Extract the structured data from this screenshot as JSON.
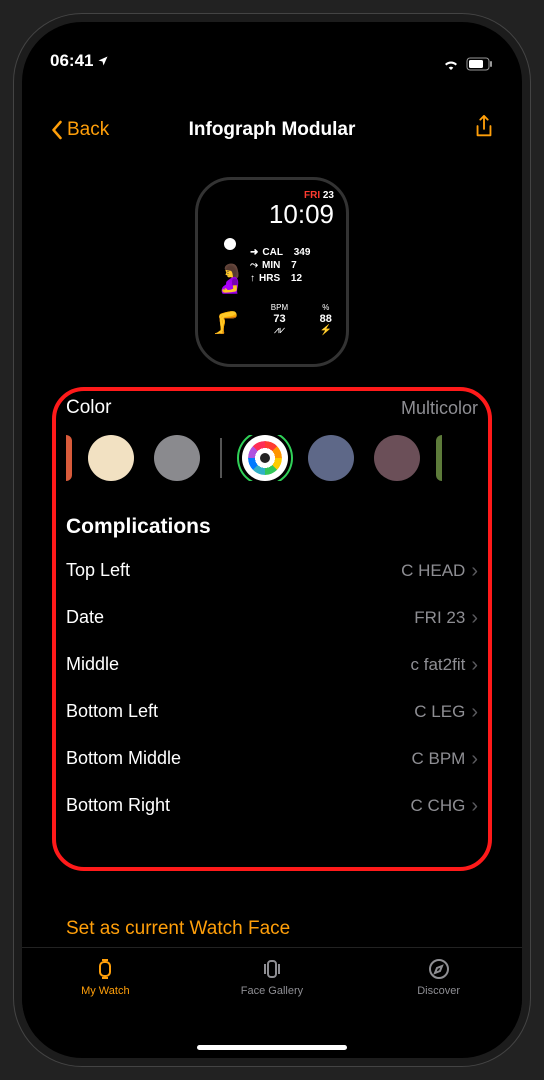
{
  "status": {
    "time": "06:41"
  },
  "nav": {
    "back": "Back",
    "title": "Infograph Modular"
  },
  "watchface": {
    "day": "FRI",
    "date": "23",
    "time": "10:09",
    "cal_label": "CAL",
    "cal": "349",
    "min_label": "MIN",
    "min": "7",
    "hrs_label": "HRS",
    "hrs": "12",
    "bpm_label": "BPM",
    "bpm": "73",
    "chg_label": "%",
    "chg": "88"
  },
  "color": {
    "label": "Color",
    "value": "Multicolor"
  },
  "swatches": [
    {
      "fill": "#f2e1c2"
    },
    {
      "fill": "#8a8a8e"
    },
    {
      "multicolor": true,
      "selected": true
    },
    {
      "fill": "#5e6888"
    },
    {
      "fill": "#6b4f58"
    }
  ],
  "complications": {
    "title": "Complications",
    "items": [
      {
        "label": "Top Left",
        "value": "C HEAD"
      },
      {
        "label": "Date",
        "value": "FRI 23"
      },
      {
        "label": "Middle",
        "value": "c fat2fit"
      },
      {
        "label": "Bottom Left",
        "value": "C LEG"
      },
      {
        "label": "Bottom Middle",
        "value": "C BPM"
      },
      {
        "label": "Bottom Right",
        "value": "C CHG"
      }
    ]
  },
  "footer": {
    "set_face": "Set as current Watch Face"
  },
  "tabs": {
    "my_watch": "My Watch",
    "face_gallery": "Face Gallery",
    "discover": "Discover"
  }
}
